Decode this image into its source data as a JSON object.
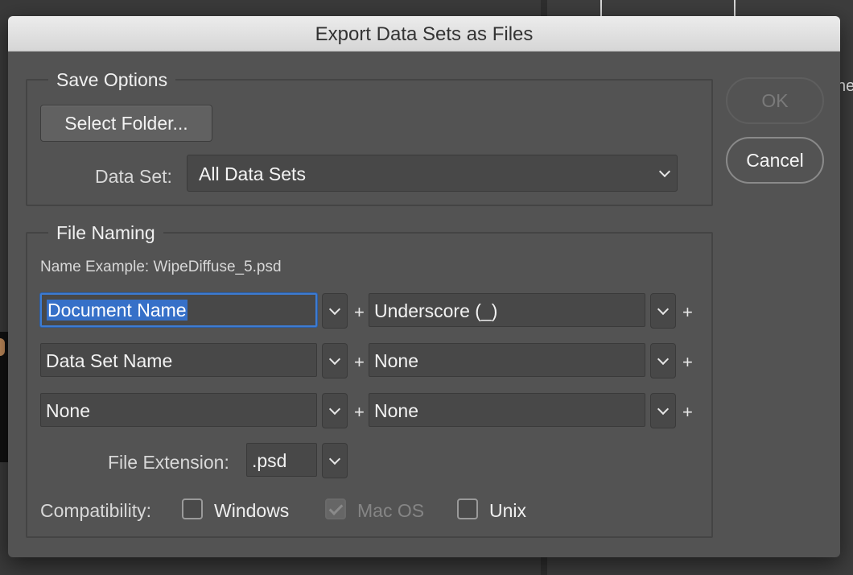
{
  "dialog": {
    "title": "Export Data Sets as Files"
  },
  "background": {
    "edge_text": "he"
  },
  "save_options": {
    "title": "Save Options",
    "select_folder_label": "Select Folder...",
    "data_set_label": "Data Set:",
    "data_set_value": "All Data Sets"
  },
  "file_naming": {
    "title": "File Naming",
    "name_example": "Name Example: WipeDiffuse_5.psd",
    "rows": [
      {
        "left": "Document Name",
        "right": "Underscore (_)"
      },
      {
        "left": "Data Set Name",
        "right": "None"
      },
      {
        "left": "None",
        "right": "None"
      }
    ],
    "plus_symbol": "+",
    "file_extension_label": "File Extension:",
    "file_extension_value": ".psd",
    "compatibility_label": "Compatibility:",
    "compat_options": [
      {
        "label": "Windows",
        "checked": false,
        "enabled": true
      },
      {
        "label": "Mac OS",
        "checked": true,
        "enabled": false
      },
      {
        "label": "Unix",
        "checked": false,
        "enabled": true
      }
    ]
  },
  "buttons": {
    "ok": "OK",
    "cancel": "Cancel"
  },
  "colors": {
    "dialog_bg": "#535353",
    "focus": "#3d7bd1",
    "selection": "#3670c8"
  }
}
